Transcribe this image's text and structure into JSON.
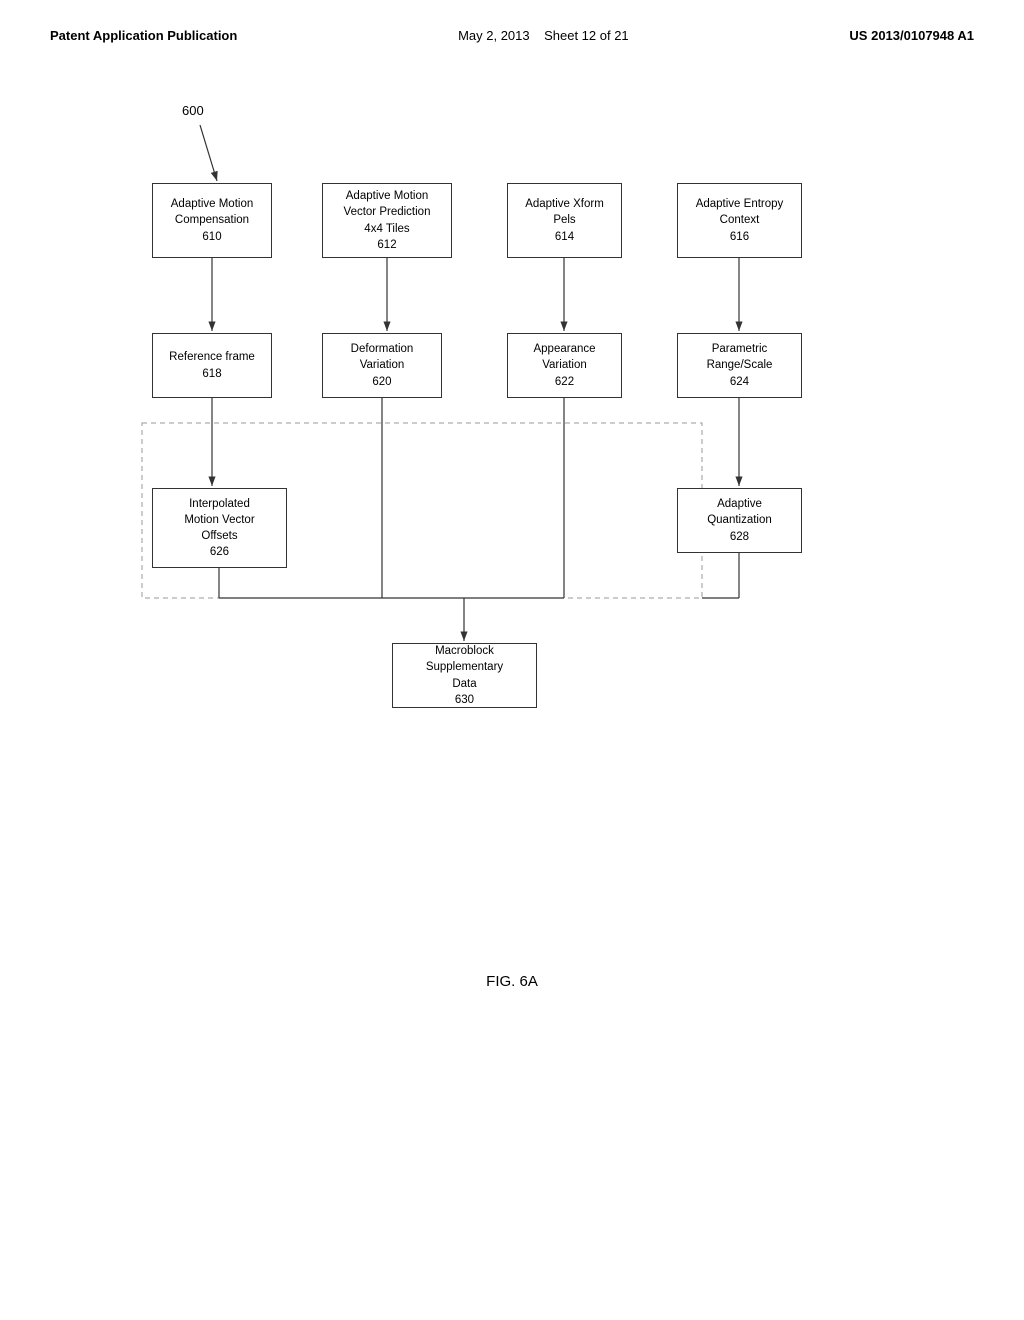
{
  "header": {
    "left": "Patent Application Publication",
    "center_date": "May 2, 2013",
    "center_sheet": "Sheet 12 of 21",
    "right": "US 2013/0107948 A1"
  },
  "diagram": {
    "label_600": "600",
    "boxes": {
      "b610": {
        "label": "Adaptive Motion\nCompensation\n610"
      },
      "b612": {
        "label": "Adaptive Motion\nVector Prediction\n4x4 Tiles\n612"
      },
      "b614": {
        "label": "Adaptive Xform\nPels\n614"
      },
      "b616": {
        "label": "Adaptive Entropy\nContext\n616"
      },
      "b618": {
        "label": "Reference frame\n618"
      },
      "b620": {
        "label": "Deformation\nVariation\n620"
      },
      "b622": {
        "label": "Appearance\nVariation\n622"
      },
      "b624": {
        "label": "Parametric\nRange/Scale\n624"
      },
      "b626": {
        "label": "Interpolated\nMotion Vector\nOffsets\n626"
      },
      "b628": {
        "label": "Adaptive\nQuantization\n628"
      },
      "b630": {
        "label": "Macroblock\nSupplementary\nData\n630"
      }
    }
  },
  "fig_label": "FIG. 6A"
}
